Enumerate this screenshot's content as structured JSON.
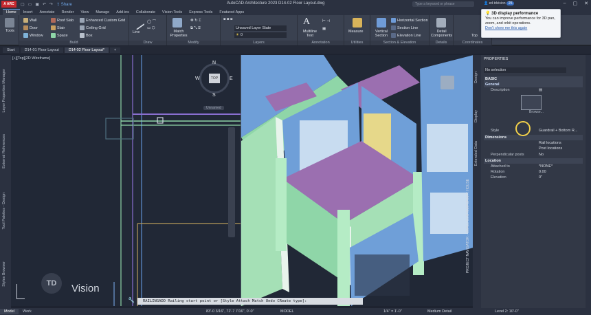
{
  "app": {
    "logo": "A ARC",
    "window_title": "AutoCAD Architecture 2023    D14-02 Floor Layout.dwg",
    "share": "Share",
    "search_placeholder": "Type a keyword or phrase",
    "user": "ed.tdvision",
    "time_badge": "25"
  },
  "ribbon_tabs": [
    "Home",
    "Insert",
    "Annotate",
    "Render",
    "View",
    "Manage",
    "Add-ins",
    "Collaborate",
    "Vision Tools",
    "Express Tools",
    "Featured Apps"
  ],
  "ribbon": {
    "tools": "Tools",
    "build": {
      "title": "Build",
      "items": [
        "Wall",
        "Door",
        "Window",
        "Roof Slab",
        "Stair",
        "Space",
        "Enhanced Custom Grid",
        "Ceiling Grid",
        "Box"
      ]
    },
    "draw": {
      "title": "Draw",
      "line": "Line"
    },
    "modify": {
      "title": "Modify",
      "match": "Match Properties"
    },
    "layers": {
      "title": "Layers",
      "layer_state": "Unsaved Layer State",
      "layer": "0"
    },
    "annotation": {
      "title": "Annotation",
      "multiline": "Multiline Text"
    },
    "utilities": {
      "title": "Utilities",
      "measure": "Measure"
    },
    "section": {
      "title": "Section & Elevation",
      "vertical": "Vertical Section",
      "h": "Horizontal Section",
      "line": "Section Line",
      "elev": "Elevation Line"
    },
    "details": {
      "title": "Details",
      "detail": "Detail Components"
    },
    "coordinates": {
      "title": "Coordinates",
      "top": "Top"
    }
  },
  "file_tabs": [
    "Start",
    "D14-01 Floor Layout",
    "D14-02 Floor Layout*"
  ],
  "viewport": {
    "label": "[+][Top][2D Wireframe]",
    "viewcube_top": "TOP",
    "compass": {
      "n": "N",
      "s": "S",
      "e": "E",
      "w": "W"
    },
    "unnamed": "Unnamed",
    "watermark": "Vision",
    "watermark_logo": "TD"
  },
  "left_palettes": [
    "Layer Properties Manager",
    "External References",
    "Tool Palettes - Design",
    "Styles Browser"
  ],
  "right_palettes": [
    "Design",
    "Display",
    "Extended Data"
  ],
  "right_vertical_text": "PROJECT NAVIGATOR - SMALL CONTEMPORARY HOUSE",
  "properties": {
    "title": "PROPERTIES",
    "selection": "No selection",
    "basic": "BASIC",
    "general": "General",
    "description": "Description",
    "style_k": "Style",
    "style_v": "Guardrail + Bottom R...",
    "dimensions": "Dimensions",
    "rail_locations": "Rail locations",
    "post_locations": "Post locations",
    "perp_k": "Perpendicular posts",
    "perp_v": "No",
    "location": "Location",
    "attached_k": "Attached to",
    "attached_v": "*NONE*",
    "rotation_k": "Rotation",
    "rotation_v": "0.00",
    "elevation_k": "Elevation",
    "elevation_v": "0\"",
    "browse": "Browse..."
  },
  "command": "RAILINGADD Railing start point or [Style Attach Match Undo CReate type]:",
  "status": {
    "model": "Model",
    "work": "Work",
    "coords": "83'-0 3/16\", 72'-7 7/16\", 0'-0\"",
    "mode": "MODEL",
    "scale": "1/4\" = 1'-0\"",
    "detail": "Medium Detail",
    "level": "Level 2: 10'-0\""
  },
  "notification": {
    "title": "3D display performance",
    "body": "You can improve performance for 3D pan, zoom, and orbit operations.",
    "link": "Don't show me this again"
  },
  "colors": {
    "accent": "#5a92d6",
    "ribbon": "#3a4150",
    "viewport": "#212836",
    "slab": "#9b6fb0",
    "wall": "#8fd6a8"
  }
}
